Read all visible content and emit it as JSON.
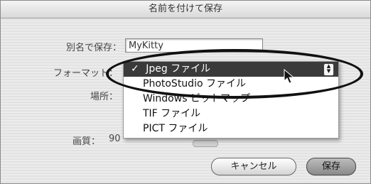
{
  "window": {
    "title": "名前を付けて保存"
  },
  "form": {
    "save_as_label": "別名で保存：",
    "filename": "MyKitty",
    "format_label": "フォーマット：",
    "location_label": "場所：",
    "quality_label": "画質：",
    "quality_value": "90"
  },
  "format_menu": {
    "check_mark": "✓",
    "items": [
      {
        "label": "Jpeg ファイル",
        "selected": true
      },
      {
        "label": "PhotoStudio ファイル",
        "selected": false
      },
      {
        "label": "Windows ビットマップ",
        "selected": false
      },
      {
        "label": "TIF ファイル",
        "selected": false
      },
      {
        "label": "PICT ファイル",
        "selected": false
      }
    ]
  },
  "buttons": {
    "cancel": "キャンセル",
    "save": "保存"
  }
}
